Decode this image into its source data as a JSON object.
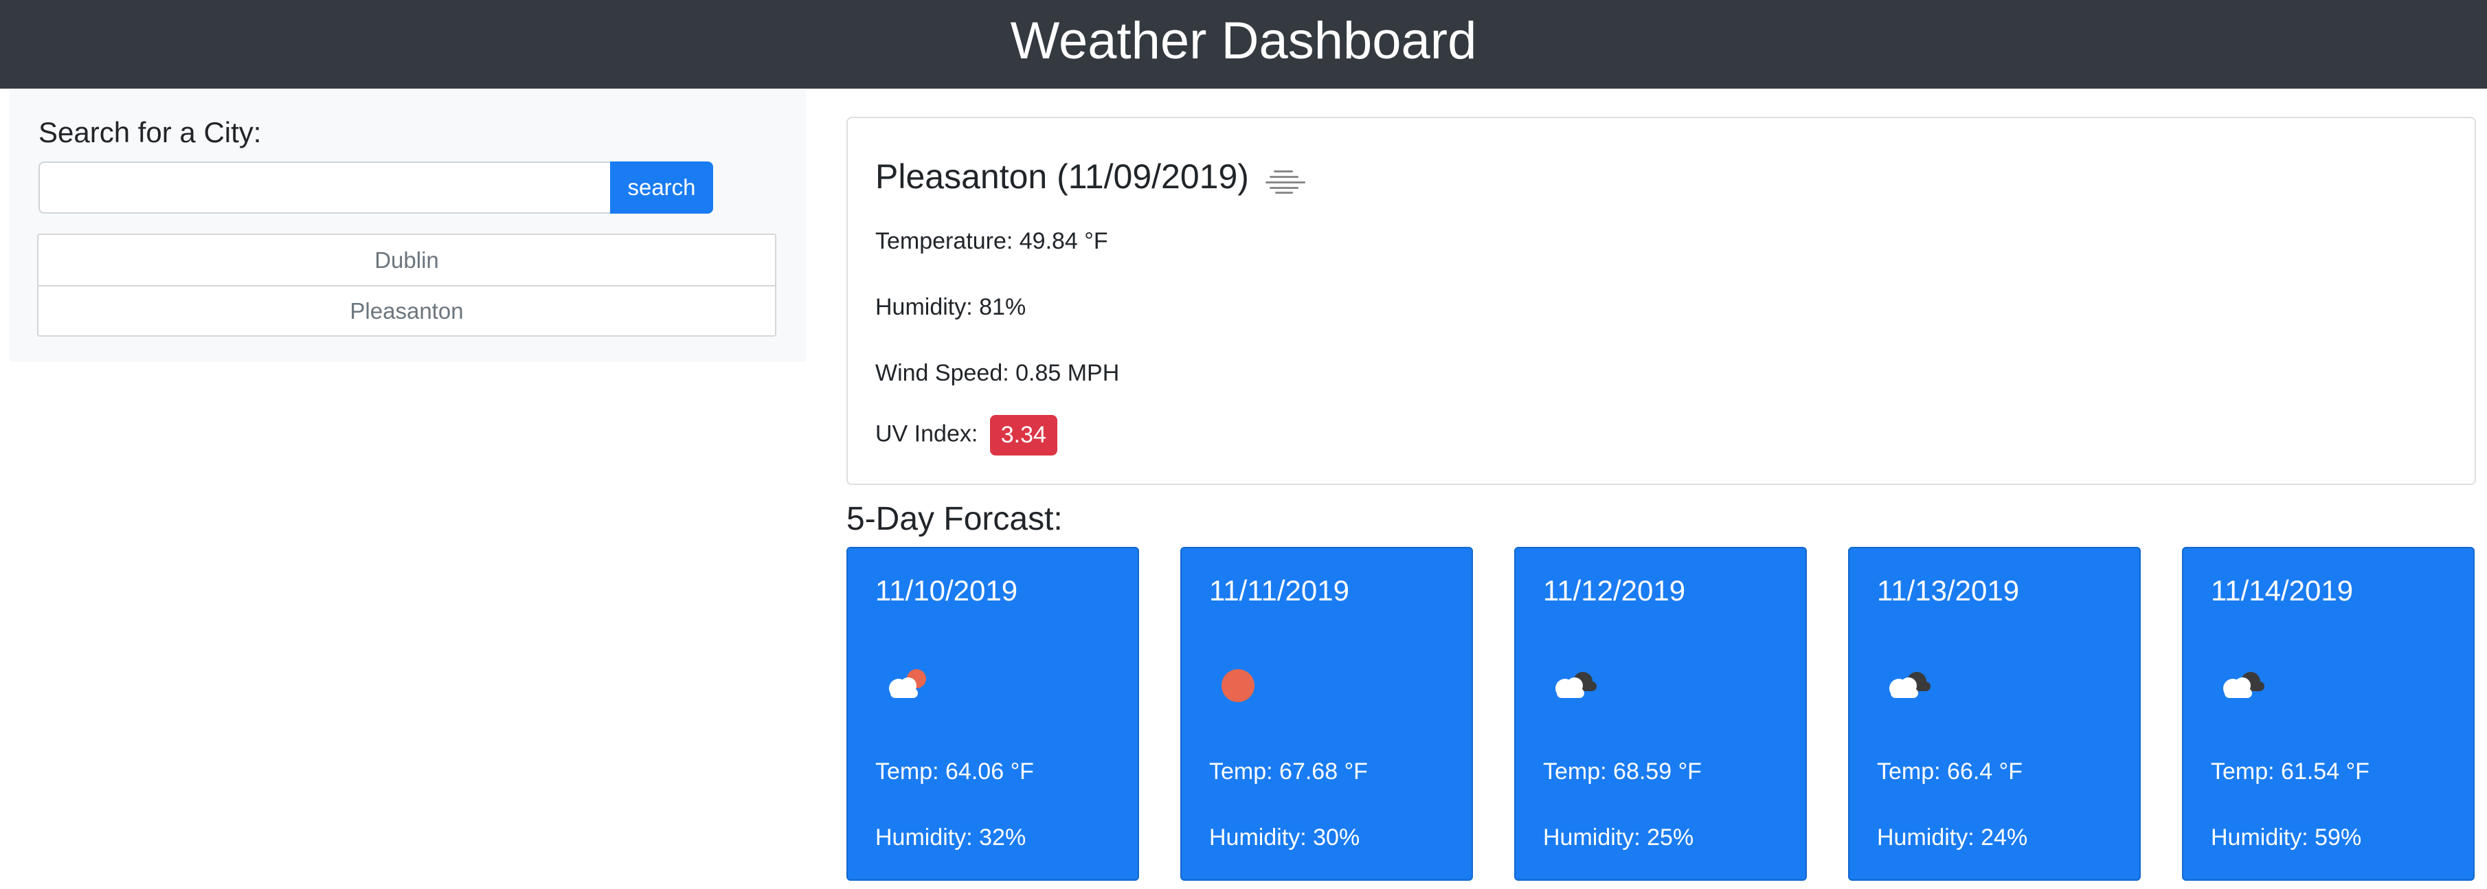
{
  "header": {
    "title": "Weather Dashboard"
  },
  "sidebar": {
    "search_label": "Search for a City:",
    "search_value": "",
    "search_placeholder": "",
    "search_button": "search",
    "cities": [
      "Dublin",
      "Pleasanton"
    ]
  },
  "current": {
    "title": "Pleasanton (11/09/2019)",
    "icon": "mist-icon",
    "temperature": "Temperature: 49.84 °F",
    "humidity": "Humidity: 81%",
    "wind": "Wind Speed: 0.85 MPH",
    "uv_label": "UV Index:",
    "uv_value": "3.34",
    "uv_color": "#dc3545"
  },
  "forecast": {
    "heading": "5-Day Forcast:",
    "accent": "#1a7cf2",
    "days": [
      {
        "date": "11/10/2019",
        "icon": "partly-cloudy-sun-icon",
        "temp": "Temp: 64.06 °F",
        "humidity": "Humidity: 32%"
      },
      {
        "date": "11/11/2019",
        "icon": "sun-icon",
        "temp": "Temp: 67.68 °F",
        "humidity": "Humidity: 30%"
      },
      {
        "date": "11/12/2019",
        "icon": "broken-clouds-icon",
        "temp": "Temp: 68.59 °F",
        "humidity": "Humidity: 25%"
      },
      {
        "date": "11/13/2019",
        "icon": "broken-clouds-icon",
        "temp": "Temp: 66.4 °F",
        "humidity": "Humidity: 24%"
      },
      {
        "date": "11/14/2019",
        "icon": "broken-clouds-icon",
        "temp": "Temp: 61.54 °F",
        "humidity": "Humidity: 59%"
      }
    ]
  }
}
